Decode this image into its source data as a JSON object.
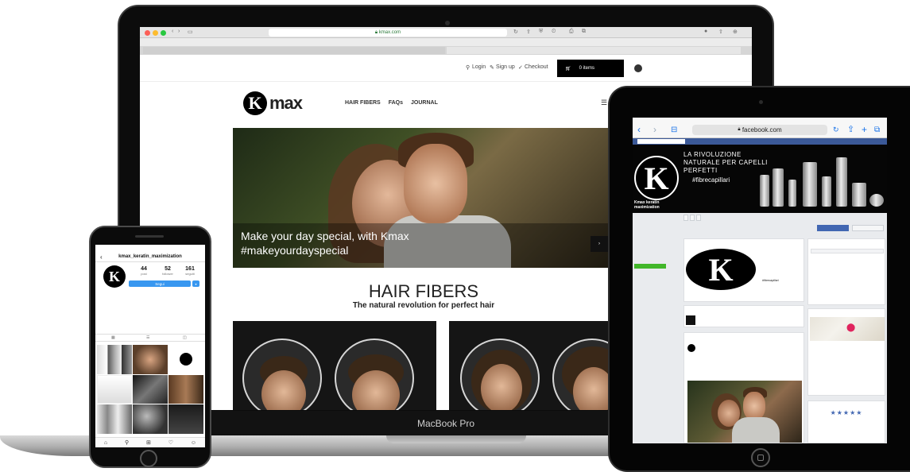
{
  "laptop": {
    "model_label": "MacBook Pro",
    "browser": {
      "url": "kmax.com",
      "bookmarks_text": "",
      "tab_left": "",
      "tab_right": ""
    },
    "site": {
      "topbar": {
        "phone_text": "",
        "login": "Login",
        "signup": "Sign up",
        "checkout": "Checkout",
        "cart": "0 items"
      },
      "logo_letter": "K",
      "logo_word": "max",
      "nav": [
        "HAIR FIBERS",
        "FAQs",
        "JOURNAL"
      ],
      "hero": {
        "line1": "Make your day special, with Kmax",
        "line2": "#makeyourdayspecial"
      },
      "section_title": "HAIR FIBERS",
      "section_subtitle": "The natural revolution for perfect hair"
    }
  },
  "phone": {
    "header_title": "kmax_keratin_maximization",
    "avatar_letter": "K",
    "stats": [
      {
        "value": "44",
        "label": "post"
      },
      {
        "value": "52",
        "label": "follower"
      },
      {
        "value": "161",
        "label": "seguiti"
      }
    ],
    "follow_label": "Segui",
    "bio_name": "",
    "bio_lines": [],
    "bio_link": ""
  },
  "tablet": {
    "safari_url": "facebook.com",
    "fb": {
      "search_placeholder": "",
      "bar_right": "",
      "cover_lines": [
        "LA RIVOLUZIONE",
        "NATURALE PER CAPELLI",
        "PERFETTI"
      ],
      "hashtag": "#fibrecapillari",
      "logo_letter": "K",
      "page_name": "Kmax keratin maximization",
      "actions": [],
      "like_button": "",
      "message_button": "",
      "left_nav": [],
      "left_active_index": 0,
      "left_button": "",
      "ad_card_title": "",
      "ad_card_sub": "",
      "post_name": "",
      "post_text": "",
      "posts_header": "",
      "community_header": "",
      "info_header": "",
      "rating_header": "",
      "rating_value": "",
      "rating_stars": "★★★★★"
    }
  }
}
